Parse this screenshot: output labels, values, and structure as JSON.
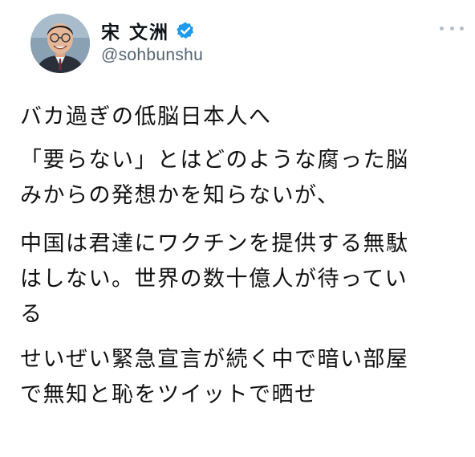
{
  "user": {
    "display_name": "宋 文洲",
    "handle": "@sohbunshu",
    "verified": true,
    "avatar_icon": "person-avatar",
    "verified_icon": "verified-badge-icon",
    "verified_color": "#1d9bf0"
  },
  "menu": {
    "more_icon": "more-options-icon"
  },
  "tweet": {
    "paragraphs": [
      {
        "lines": [
          "バカ過ぎの低脳日本人へ"
        ]
      },
      {
        "lines": [
          "「要らない」とはどのような腐った脳",
          "みからの発想かを知らないが、"
        ]
      },
      {
        "lines": [
          "中国は君達にワクチンを提供する無駄",
          "はしない。世界の数十億人が待ってい",
          "る"
        ]
      },
      {
        "lines": [
          "せいぜい緊急宣言が続く中で暗い部屋",
          "で無知と恥をツイットで晒せ"
        ]
      }
    ]
  }
}
